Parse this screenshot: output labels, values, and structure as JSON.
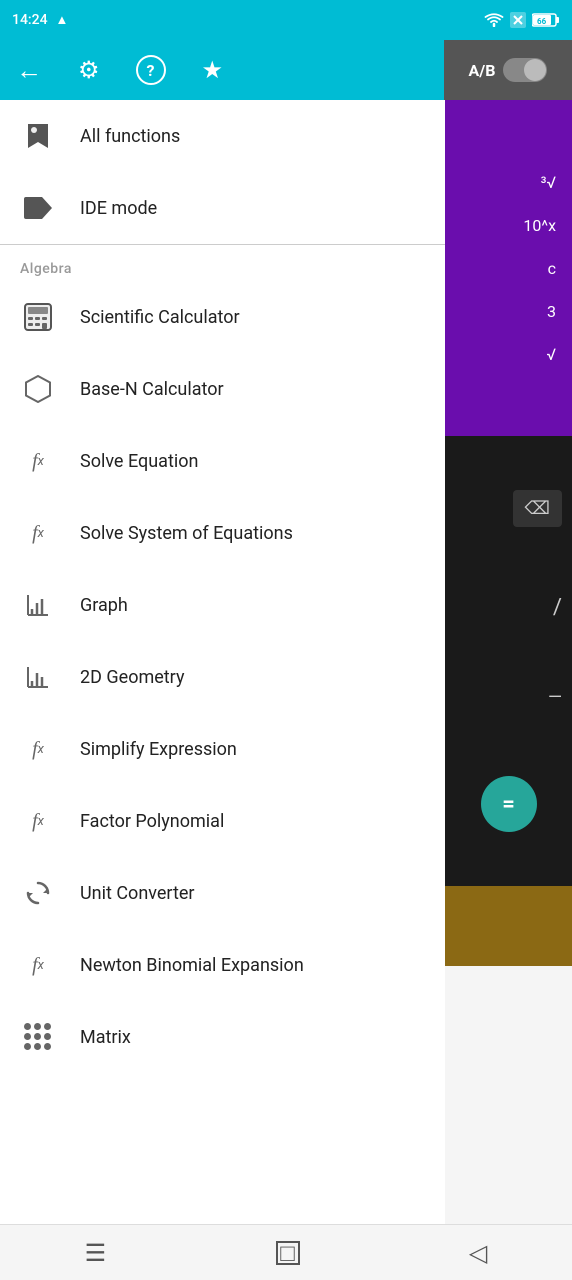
{
  "statusBar": {
    "time": "14:24",
    "warning": "▲",
    "wifi": "wifi",
    "battery": "66"
  },
  "topBar": {
    "backIcon": "←",
    "settingsIcon": "⚙",
    "helpIcon": "?",
    "starIcon": "★",
    "abLabel": "A/B"
  },
  "menu": {
    "items": [
      {
        "id": "all-functions",
        "label": "All functions",
        "icon": "bookmark"
      },
      {
        "id": "ide-mode",
        "label": "IDE mode",
        "icon": "tag"
      }
    ],
    "sectionHeader": "Algebra",
    "algebraItems": [
      {
        "id": "scientific-calculator",
        "label": "Scientific Calculator",
        "icon": "calc"
      },
      {
        "id": "base-n-calculator",
        "label": "Base-N Calculator",
        "icon": "hexagon"
      },
      {
        "id": "solve-equation",
        "label": "Solve Equation",
        "icon": "fx"
      },
      {
        "id": "solve-system",
        "label": "Solve System of Equations",
        "icon": "fx"
      },
      {
        "id": "graph",
        "label": "Graph",
        "icon": "graph"
      },
      {
        "id": "2d-geometry",
        "label": "2D Geometry",
        "icon": "graph"
      },
      {
        "id": "simplify-expression",
        "label": "Simplify Expression",
        "icon": "fx"
      },
      {
        "id": "factor-polynomial",
        "label": "Factor Polynomial",
        "icon": "fx"
      },
      {
        "id": "unit-converter",
        "label": "Unit Converter",
        "icon": "refresh"
      },
      {
        "id": "newton-binomial",
        "label": "Newton Binomial Expansion",
        "icon": "fx"
      },
      {
        "id": "matrix",
        "label": "Matrix",
        "icon": "dots"
      }
    ]
  },
  "navBar": {
    "menuIcon": "☰",
    "homeIcon": "□",
    "backIcon": "◁"
  },
  "rightPanel": {
    "cubeRoot": "³√",
    "powLabel": "10^x",
    "cLabel": "c",
    "threeLabel": "3",
    "sqrtLabel": "√",
    "backspace": "⌫",
    "divIcon": "/",
    "minusLine": "—",
    "equalsIcon": "="
  }
}
